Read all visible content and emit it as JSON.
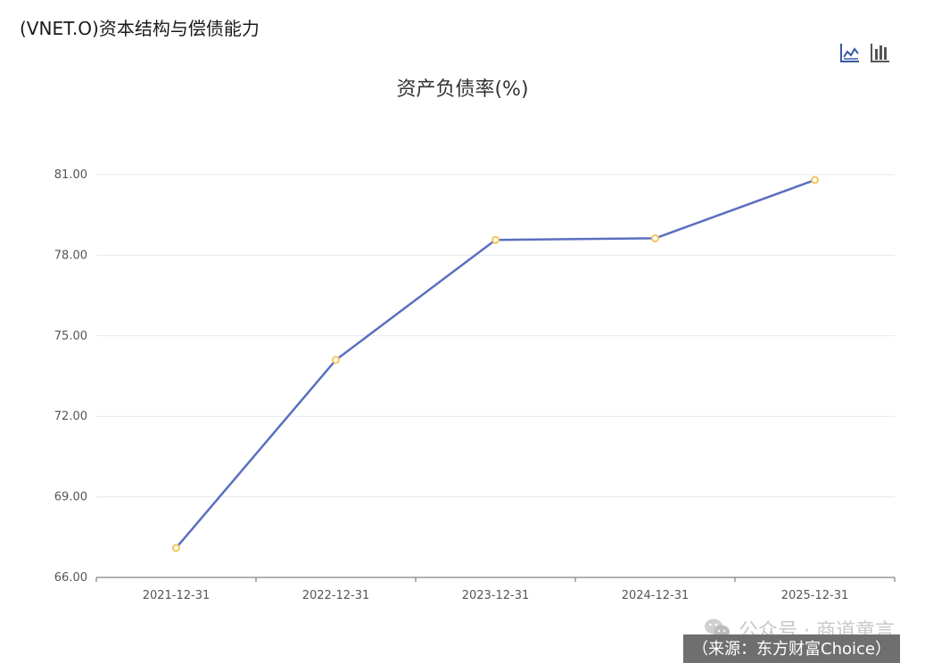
{
  "header": {
    "title": "(VNET.O)资本结构与偿债能力"
  },
  "toolbar": {
    "line_icon": "line-chart-icon",
    "bar_icon": "bar-chart-icon"
  },
  "footer": {
    "watermark": "公众号 · 商道童言",
    "source": "（来源：东方财富Choice）"
  },
  "chart_data": {
    "type": "line",
    "title": "资产负债率(%)",
    "categories": [
      "2021-12-31",
      "2022-12-31",
      "2023-12-31",
      "2024-12-31",
      "2025-12-31"
    ],
    "series": [
      {
        "values": [
          67.1,
          74.1,
          78.57,
          78.63,
          80.8
        ]
      }
    ],
    "ylim": [
      66.0,
      81.0
    ],
    "yticks": [
      "66.00",
      "69.00",
      "72.00",
      "75.00",
      "78.00",
      "81.00"
    ],
    "grid": true,
    "colors": {
      "line": "#5b6fc0",
      "marker_fill": "#ffffff",
      "marker_stroke": "#f2c65a",
      "grid": "#e3e9f2",
      "axis": "#666666"
    }
  }
}
